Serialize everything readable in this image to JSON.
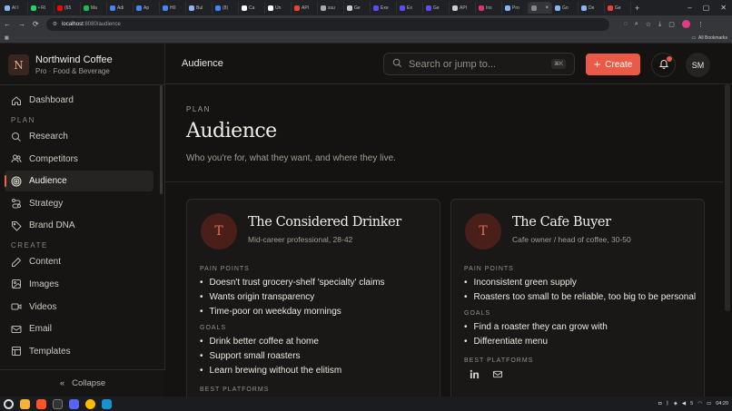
{
  "browser": {
    "tabs": [
      {
        "label": "AI I",
        "color": "#8ab4f8"
      },
      {
        "label": "• RI",
        "color": "#25d366"
      },
      {
        "label": "(65",
        "color": "#ff0000"
      },
      {
        "label": "Ma",
        "color": "#1db954"
      },
      {
        "label": "Adi",
        "color": "#4285f4"
      },
      {
        "label": "Ap",
        "color": "#4285f4"
      },
      {
        "label": "H0",
        "color": "#4285f4"
      },
      {
        "label": "Bul",
        "color": "#8ab4f8"
      },
      {
        "label": "(8)",
        "color": "#4285f4"
      },
      {
        "label": "Ca",
        "color": "#ffffff"
      },
      {
        "label": "Un",
        "color": "#ffffff"
      },
      {
        "label": "API",
        "color": "#ea4335"
      },
      {
        "label": "ssu",
        "color": "#aaaaaa"
      },
      {
        "label": "Ge",
        "color": "#cccccc"
      },
      {
        "label": "Exe",
        "color": "#5b4bff"
      },
      {
        "label": "Ex",
        "color": "#5b4bff"
      },
      {
        "label": "Ge",
        "color": "#5b4bff"
      },
      {
        "label": "API",
        "color": "#cccccc"
      },
      {
        "label": "Ins",
        "color": "#e1306c"
      },
      {
        "label": "Pro",
        "color": "#8ab4f8"
      },
      {
        "label": "",
        "color": "#888888",
        "active": true
      },
      {
        "label": "Go",
        "color": "#8ab4f8"
      },
      {
        "label": "De",
        "color": "#8ab4f8"
      },
      {
        "label": "Ge",
        "color": "#ea4335"
      }
    ],
    "url_host": "localhost",
    "url_path": ":8080/audience",
    "bookmarks_label": "All Bookmarks"
  },
  "sidebar": {
    "brand_initial": "N",
    "brand_name": "Northwind Coffee",
    "brand_sub": "Pro · Food & Beverage",
    "dashboard": "Dashboard",
    "plan_label": "PLAN",
    "plan_items": [
      "Research",
      "Competitors",
      "Audience",
      "Strategy",
      "Brand DNA"
    ],
    "create_label": "CREATE",
    "create_items": [
      "Content",
      "Images",
      "Videos",
      "Email",
      "Templates"
    ],
    "collapse": "Collapse"
  },
  "topbar": {
    "title": "Audience",
    "search_placeholder": "Search or jump to...",
    "search_kbd": "⌘K",
    "create": "Create",
    "user_initials": "SM"
  },
  "hero": {
    "eyebrow": "PLAN",
    "title": "Audience",
    "lede": "Who you're for, what they want, and where they live."
  },
  "personas": [
    {
      "initial": "T",
      "name": "The Considered Drinker",
      "role": "Mid-career professional, 28-42",
      "pain_label": "PAIN POINTS",
      "pain": [
        "Doesn't trust grocery-shelf 'specialty' claims",
        "Wants origin transparency",
        "Time-poor on weekday mornings"
      ],
      "goals_label": "GOALS",
      "goals": [
        "Drink better coffee at home",
        "Support small roasters",
        "Learn brewing without the elitism"
      ],
      "platforms_label": "BEST PLATFORMS"
    },
    {
      "initial": "T",
      "name": "The Cafe Buyer",
      "role": "Cafe owner / head of coffee, 30-50",
      "pain_label": "PAIN POINTS",
      "pain": [
        "Inconsistent green supply",
        "Roasters too small to be reliable, too big to be personal"
      ],
      "goals_label": "GOALS",
      "goals": [
        "Find a roaster they can grow with",
        "Differentiate menu"
      ],
      "platforms_label": "BEST PLATFORMS",
      "platforms": [
        "linkedin-icon",
        "mail-icon"
      ]
    }
  ],
  "taskbar": {
    "tray_num": "5",
    "time": "04:20"
  }
}
